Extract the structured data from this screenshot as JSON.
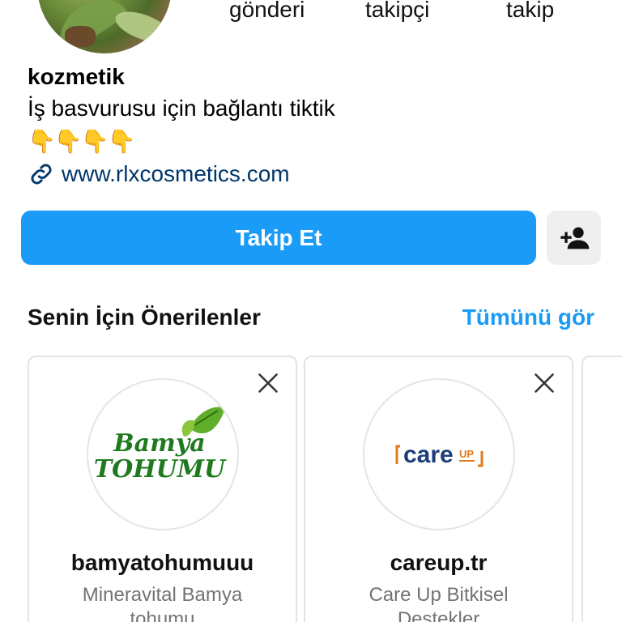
{
  "profile": {
    "stats": [
      "gönderi",
      "takipçi",
      "takip"
    ],
    "username": "kozmetik",
    "bio": "İş basvurusu için bağlantı tiktik",
    "emoji": "👇👇👇👇",
    "website": "www.rlxcosmetics.com"
  },
  "actions": {
    "follow_label": "Takip Et"
  },
  "suggestions": {
    "title": "Senin İçin Önerilenler",
    "see_all": "Tümünü gör",
    "cards": [
      {
        "logo_line1": "Bamya",
        "logo_line2": "TOHUMU",
        "name": "bamyatohumuuu",
        "subtitle_line1": "Mineravital Bamya",
        "subtitle_line2": "tohumu"
      },
      {
        "logo_main": "care",
        "logo_up": "UP",
        "name": "careup.tr",
        "subtitle_line1": "Care Up Bitkisel",
        "subtitle_line2": "Destekler"
      }
    ]
  },
  "colors": {
    "accent": "#1a9bf7",
    "link": "#00376b",
    "muted": "#737373"
  }
}
